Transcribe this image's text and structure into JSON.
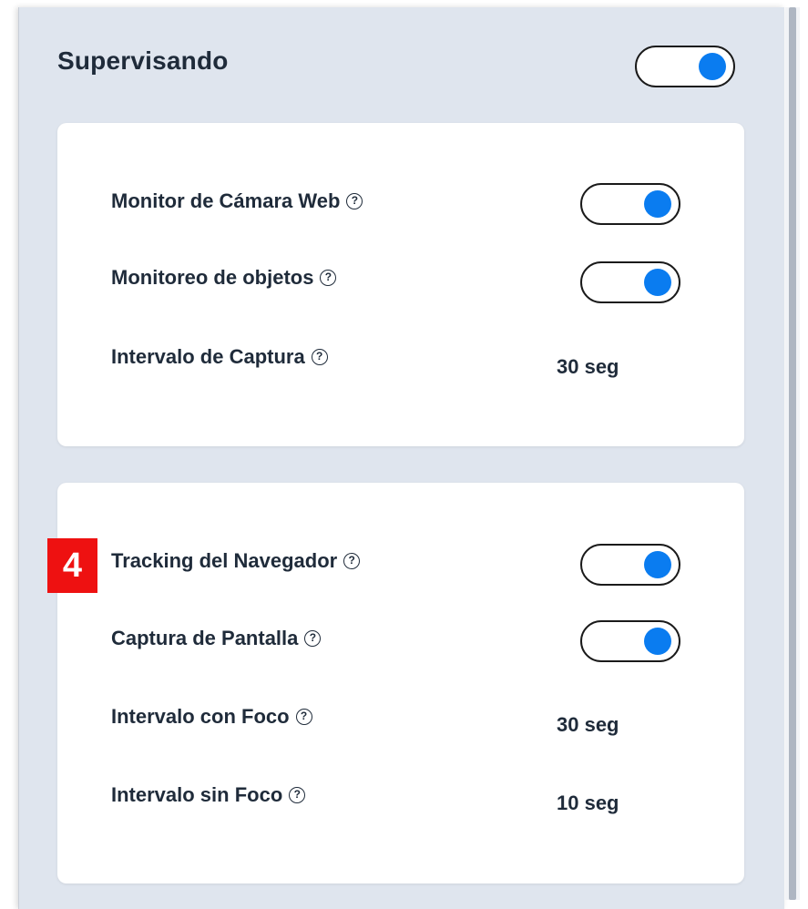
{
  "header": {
    "title": "Supervisando",
    "toggle_on": true
  },
  "card1": {
    "rows": [
      {
        "label": "Monitor de Cámara Web",
        "help": "?",
        "type": "toggle",
        "on": true
      },
      {
        "label": "Monitoreo de objetos",
        "help": "?",
        "type": "toggle",
        "on": true
      },
      {
        "label": "Intervalo de Captura",
        "help": "?",
        "type": "value",
        "value": "30 seg"
      }
    ]
  },
  "card2": {
    "rows": [
      {
        "label": "Tracking del Navegador",
        "help": "?",
        "type": "toggle",
        "on": true
      },
      {
        "label": "Captura de Pantalla",
        "help": "?",
        "type": "toggle",
        "on": true
      },
      {
        "label": "Intervalo con Foco",
        "help": "?",
        "type": "value",
        "value": "30 seg"
      },
      {
        "label": "Intervalo sin Foco",
        "help": "?",
        "type": "value",
        "value": "10 seg"
      }
    ]
  },
  "badge": {
    "label": "4"
  },
  "colors": {
    "panel_bg": "#dfe5ee",
    "toggle_knob": "#0a7cf0",
    "badge_bg": "#ee1111",
    "text": "#1f2b3a"
  }
}
